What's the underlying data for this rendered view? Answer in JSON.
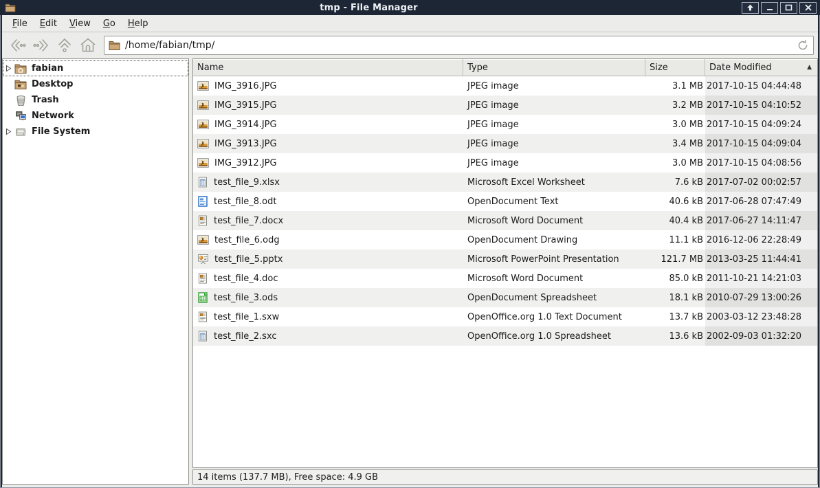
{
  "window": {
    "title": "tmp - File Manager",
    "controls": [
      {
        "name": "shade",
        "glyph": "arrow-up"
      },
      {
        "name": "minimize",
        "glyph": "dash"
      },
      {
        "name": "maximize",
        "glyph": "square"
      },
      {
        "name": "close",
        "glyph": "x"
      }
    ]
  },
  "menubar": {
    "items": [
      {
        "label": "File",
        "mnemonic_index": 0
      },
      {
        "label": "Edit",
        "mnemonic_index": 0
      },
      {
        "label": "View",
        "mnemonic_index": 0
      },
      {
        "label": "Go",
        "mnemonic_index": 0
      },
      {
        "label": "Help",
        "mnemonic_index": 0
      }
    ]
  },
  "toolbar": {
    "buttons": [
      {
        "name": "back",
        "icon": "back-icon"
      },
      {
        "name": "forward",
        "icon": "forward-icon"
      },
      {
        "name": "up",
        "icon": "up-icon"
      },
      {
        "name": "home",
        "icon": "home-icon"
      }
    ],
    "path": "/home/fabian/tmp/",
    "path_icon": "folder-icon",
    "reload_icon": "reload-icon"
  },
  "sidebar": {
    "items": [
      {
        "label": "fabian",
        "icon": "home-folder",
        "expander": true,
        "focused": true
      },
      {
        "label": "Desktop",
        "icon": "desktop-folder",
        "expander": false,
        "focused": false
      },
      {
        "label": "Trash",
        "icon": "trash",
        "expander": false,
        "focused": false
      },
      {
        "label": "Network",
        "icon": "network",
        "expander": false,
        "focused": false
      },
      {
        "label": "File System",
        "icon": "filesystem",
        "expander": true,
        "focused": false
      }
    ]
  },
  "list": {
    "columns": [
      {
        "label": "Name",
        "key": "name"
      },
      {
        "label": "Type",
        "key": "type"
      },
      {
        "label": "Size",
        "key": "size"
      },
      {
        "label": "Date Modified",
        "key": "date",
        "sorted": true,
        "sort_arrow": "▲"
      }
    ],
    "rows": [
      {
        "name": "IMG_3916.JPG",
        "icon": "photo",
        "type": "JPEG image",
        "size": "3.1 MB",
        "date": "2017-10-15 04:44:48"
      },
      {
        "name": "IMG_3915.JPG",
        "icon": "photo",
        "type": "JPEG image",
        "size": "3.2 MB",
        "date": "2017-10-15 04:10:52"
      },
      {
        "name": "IMG_3914.JPG",
        "icon": "photo",
        "type": "JPEG image",
        "size": "3.0 MB",
        "date": "2017-10-15 04:09:24"
      },
      {
        "name": "IMG_3913.JPG",
        "icon": "photo",
        "type": "JPEG image",
        "size": "3.4 MB",
        "date": "2017-10-15 04:09:04"
      },
      {
        "name": "IMG_3912.JPG",
        "icon": "photo",
        "type": "JPEG image",
        "size": "3.0 MB",
        "date": "2017-10-15 04:08:56"
      },
      {
        "name": "test_file_9.xlsx",
        "icon": "sheet-blue",
        "type": "Microsoft Excel Worksheet",
        "size": "7.6 kB",
        "date": "2017-07-02 00:02:57"
      },
      {
        "name": "test_file_8.odt",
        "icon": "doc-odt",
        "type": "OpenDocument Text",
        "size": "40.6 kB",
        "date": "2017-06-28 07:47:49"
      },
      {
        "name": "test_file_7.docx",
        "icon": "doc-word",
        "type": "Microsoft Word Document",
        "size": "40.4 kB",
        "date": "2017-06-27 14:11:47"
      },
      {
        "name": "test_file_6.odg",
        "icon": "photo",
        "type": "OpenDocument Drawing",
        "size": "11.1 kB",
        "date": "2016-12-06 22:28:49"
      },
      {
        "name": "test_file_5.pptx",
        "icon": "presentation",
        "type": "Microsoft PowerPoint Presentation",
        "size": "121.7 MB",
        "date": "2013-03-25 11:44:41"
      },
      {
        "name": "test_file_4.doc",
        "icon": "doc-word",
        "type": "Microsoft Word Document",
        "size": "85.0 kB",
        "date": "2011-10-21 14:21:03"
      },
      {
        "name": "test_file_3.ods",
        "icon": "sheet-green",
        "type": "OpenDocument Spreadsheet",
        "size": "18.1 kB",
        "date": "2010-07-29 13:00:26"
      },
      {
        "name": "test_file_1.sxw",
        "icon": "doc-word",
        "type": "OpenOffice.org 1.0 Text Document",
        "size": "13.7 kB",
        "date": "2003-03-12 23:48:28"
      },
      {
        "name": "test_file_2.sxc",
        "icon": "sheet-blue",
        "type": "OpenOffice.org 1.0 Spreadsheet",
        "size": "13.6 kB",
        "date": "2002-09-03 01:32:20"
      }
    ]
  },
  "statusbar": {
    "text": "14 items (137.7 MB), Free space: 4.9 GB"
  },
  "colors": {
    "titlebar_bg": "#1d2635",
    "titlebar_text": "#eef1f5",
    "chrome_bg": "#ececea",
    "panel_bg": "#ffffff",
    "row_stripe": "#f0f0ee",
    "sorted_column_tint": "#e7e7e4",
    "border": "#949490",
    "folder_tan": "#c1996a"
  }
}
